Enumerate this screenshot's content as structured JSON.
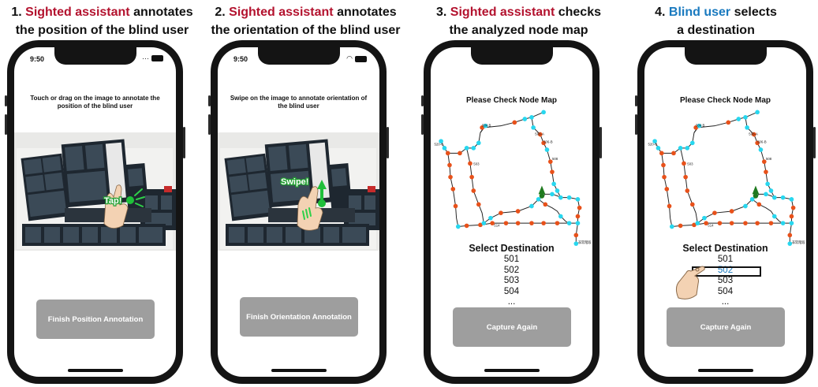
{
  "panels": [
    {
      "caption": {
        "pre": "1. ",
        "highlight": "Sighted assistant",
        "highlight_color": "#b3122e",
        "post": " annotates",
        "line2": "the position of the blind user"
      },
      "status_time": "9:50",
      "instruction": "Touch or drag on the image to annotate the position of the blind user",
      "gesture_label": "Tap!",
      "button_label": "Finish Position Annotation"
    },
    {
      "caption": {
        "pre": "2. ",
        "highlight": "Sighted assistant",
        "highlight_color": "#b3122e",
        "post": " annotates",
        "line2": "the orientation of the blind user"
      },
      "status_time": "9:50",
      "instruction": "Swipe on the image to annotate orientation of the blind user",
      "gesture_label": "Swipe!",
      "button_label": "Finish Orientation Annotation"
    },
    {
      "caption": {
        "pre": "3. ",
        "highlight": "Sighted assistant",
        "highlight_color": "#b3122e",
        "post": " checks",
        "line2": "the analyzed node map"
      },
      "map_title": "Please Check Node Map",
      "select_title": "Select Destination",
      "destinations": [
        "501",
        "502",
        "503",
        "504",
        "..."
      ],
      "button_label": "Capture Again"
    },
    {
      "caption": {
        "pre": "4. ",
        "highlight": "Blind user",
        "highlight_color": "#1a7abf",
        "post": " selects",
        "line2": "a destination"
      },
      "map_title": "Please Check Node Map",
      "select_title": "Select Destination",
      "destinations": [
        "501",
        "502",
        "503",
        "504",
        "..."
      ],
      "selected_destination": "502",
      "button_label": "Capture Again"
    }
  ],
  "node_labels": [
    "504 B",
    "505",
    "506-A",
    "506-B",
    "508",
    "507",
    "509",
    "520-C",
    "503",
    "502",
    "519",
    "518",
    "501",
    "516-B",
    "515-A",
    "514",
    "513",
    "511",
    "EV",
    "トイレ",
    "非常階段"
  ],
  "colors": {
    "node_orange": "#e8511a",
    "node_cyan": "#27d7ef",
    "edge": "#222222",
    "button_grey": "#9e9e9e"
  }
}
